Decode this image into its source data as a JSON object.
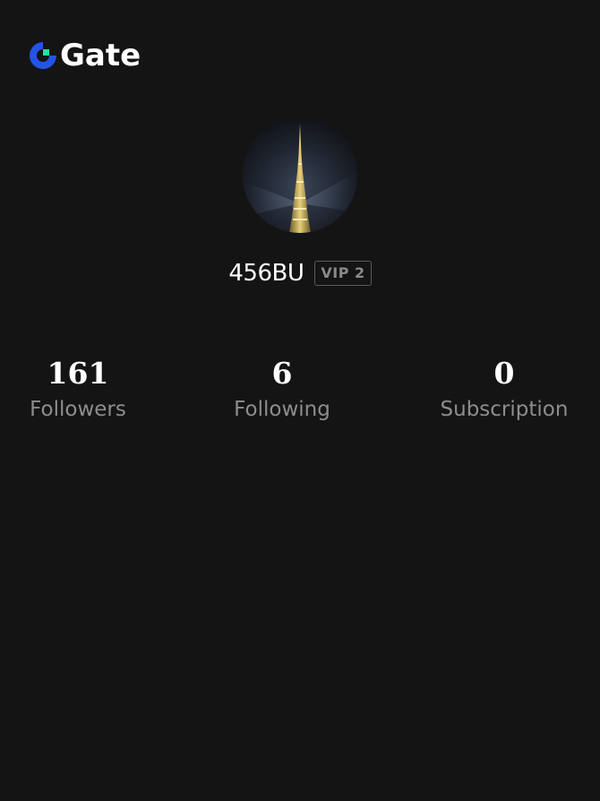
{
  "brand": {
    "name": "Gate",
    "logo_icon": "gate-logo-icon"
  },
  "profile": {
    "avatar_icon": "burj-khalifa-avatar",
    "username": "456BU",
    "vip_badge": "VIP 2"
  },
  "stats": [
    {
      "value": "161",
      "label": "Followers"
    },
    {
      "value": "6",
      "label": "Following"
    },
    {
      "value": "0",
      "label": "Subscription"
    }
  ],
  "colors": {
    "background": "#141415",
    "text_primary": "#ffffff",
    "text_secondary": "#8d8d90",
    "logo_blue": "#2354e6",
    "logo_green": "#17e6a1"
  }
}
